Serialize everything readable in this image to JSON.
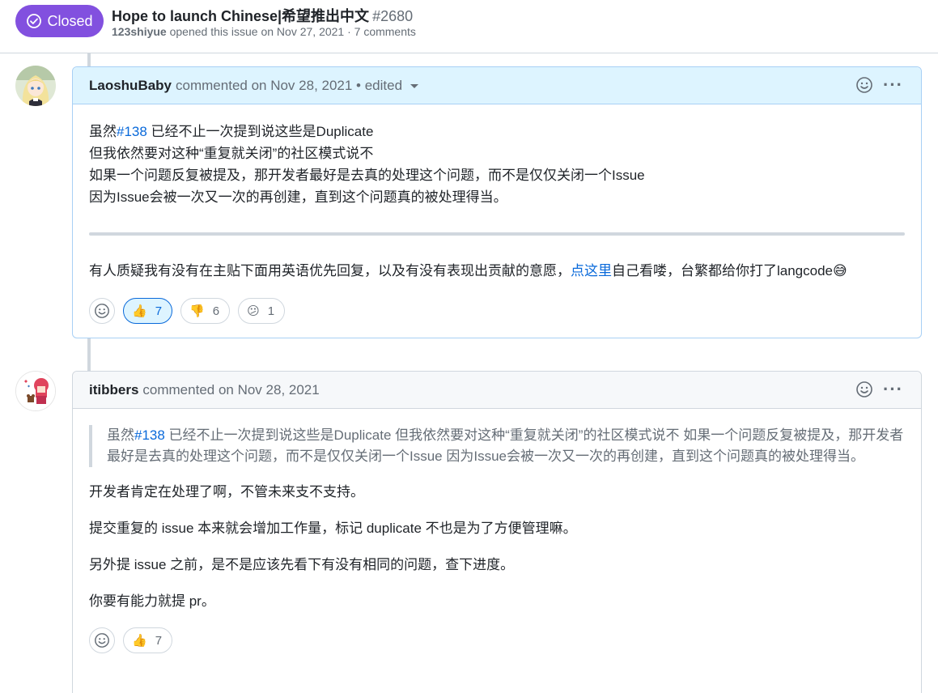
{
  "issue": {
    "state": "Closed",
    "title": "Hope to launch Chinese|希望推出中文",
    "number": "#2680",
    "author": "123shiyue",
    "meta_rest": "opened this issue on Nov 27, 2021 · 7 comments"
  },
  "comments": [
    {
      "author": "LaoshuBaby",
      "action": "commented on Nov 28, 2021 • edited",
      "lines": [
        {
          "pre": "虽然",
          "link": "#138",
          "post": " 已经不止一次提到说这些是Duplicate"
        },
        {
          "text": "但我依然要对这种“重复就关闭”的社区模式说不"
        },
        {
          "text": "如果一个问题反复被提及，那开发者最好是去真的处理这个问题，而不是仅仅关闭一个Issue"
        },
        {
          "text": "因为Issue会被一次又一次的再创建，直到这个问题真的被处理得当。"
        }
      ],
      "footer": {
        "pre": "有人质疑我有没有在主贴下面用英语优先回复，以及有没有表现出贡献的意愿，",
        "link": "点这里",
        "post": "自己看喽，台繁都给你打了langcode"
      },
      "reactions": [
        {
          "emoji": "👍",
          "count": "7",
          "name": "thumbs-up"
        },
        {
          "emoji": "👎",
          "count": "6",
          "name": "thumbs-down"
        },
        {
          "emoji": "😕",
          "count": "1",
          "name": "confused"
        }
      ]
    },
    {
      "author": "itibbers",
      "action": "commented on Nov 28, 2021",
      "quote_pre": "虽然",
      "quote_link": "#138",
      "quote_post": " 已经不止一次提到说这些是Duplicate 但我依然要对这种“重复就关闭”的社区模式说不 如果一个问题反复被提及，那开发者最好是去真的处理这个问题，而不是仅仅关闭一个Issue 因为Issue会被一次又一次的再创建，直到这个问题真的被处理得当。",
      "paragraphs": [
        "开发者肯定在处理了啊，不管未来支不支持。",
        "提交重复的 issue 本来就会增加工作量，标记 duplicate 不也是为了方便管理嘛。",
        "另外提 issue 之前，是不是应该先看下有没有相同的问题，查下进度。",
        "你要有能力就提 pr。"
      ],
      "reactions": [
        {
          "emoji": "👍",
          "count": "7",
          "name": "thumbs-up"
        }
      ]
    }
  ],
  "colors": {
    "closed": "#8250df",
    "link": "#0969da",
    "header_bg_own": "#ddf4ff",
    "border": "#d0d7de"
  }
}
